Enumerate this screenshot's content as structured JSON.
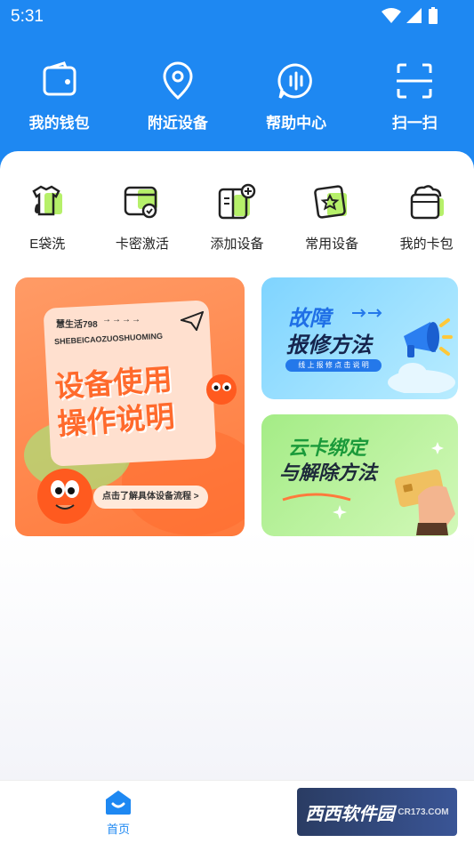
{
  "status_bar": {
    "time": "5:31"
  },
  "quick_actions": [
    {
      "label": "我的钱包",
      "icon": "wallet-icon"
    },
    {
      "label": "附近设备",
      "icon": "location-pin-icon"
    },
    {
      "label": "帮助中心",
      "icon": "voice-chat-icon"
    },
    {
      "label": "扫一扫",
      "icon": "scan-icon"
    }
  ],
  "services": [
    {
      "label": "E袋洗",
      "icon": "shirt-wash-icon"
    },
    {
      "label": "卡密激活",
      "icon": "card-activate-icon"
    },
    {
      "label": "添加设备",
      "icon": "add-device-icon"
    },
    {
      "label": "常用设备",
      "icon": "favorite-device-icon"
    },
    {
      "label": "我的卡包",
      "icon": "card-wallet-icon"
    }
  ],
  "banners": {
    "guide": {
      "small": "慧生活798",
      "arrows": "→→→→",
      "pinyin": "SHEBEICAOZUOSHUOMING",
      "line1": "设备使用",
      "line2": "操作说明",
      "cta": "点击了解具体设备流程 >"
    },
    "repair": {
      "line1": "故障",
      "line2": "报修方法",
      "pill": "线 上 报 修 点 击 说 明"
    },
    "cloud_card": {
      "line1": "云卡绑定",
      "line2": "与解除方法"
    }
  },
  "tabbar": {
    "home_label": "首页"
  },
  "watermark": {
    "text": "西西软件园",
    "sub": "CR173.COM"
  },
  "colors": {
    "primary": "#1e88f2",
    "orange": "#ff7a3c",
    "blue_banner": "#7fd4ff",
    "green_banner": "#a4ec86"
  }
}
